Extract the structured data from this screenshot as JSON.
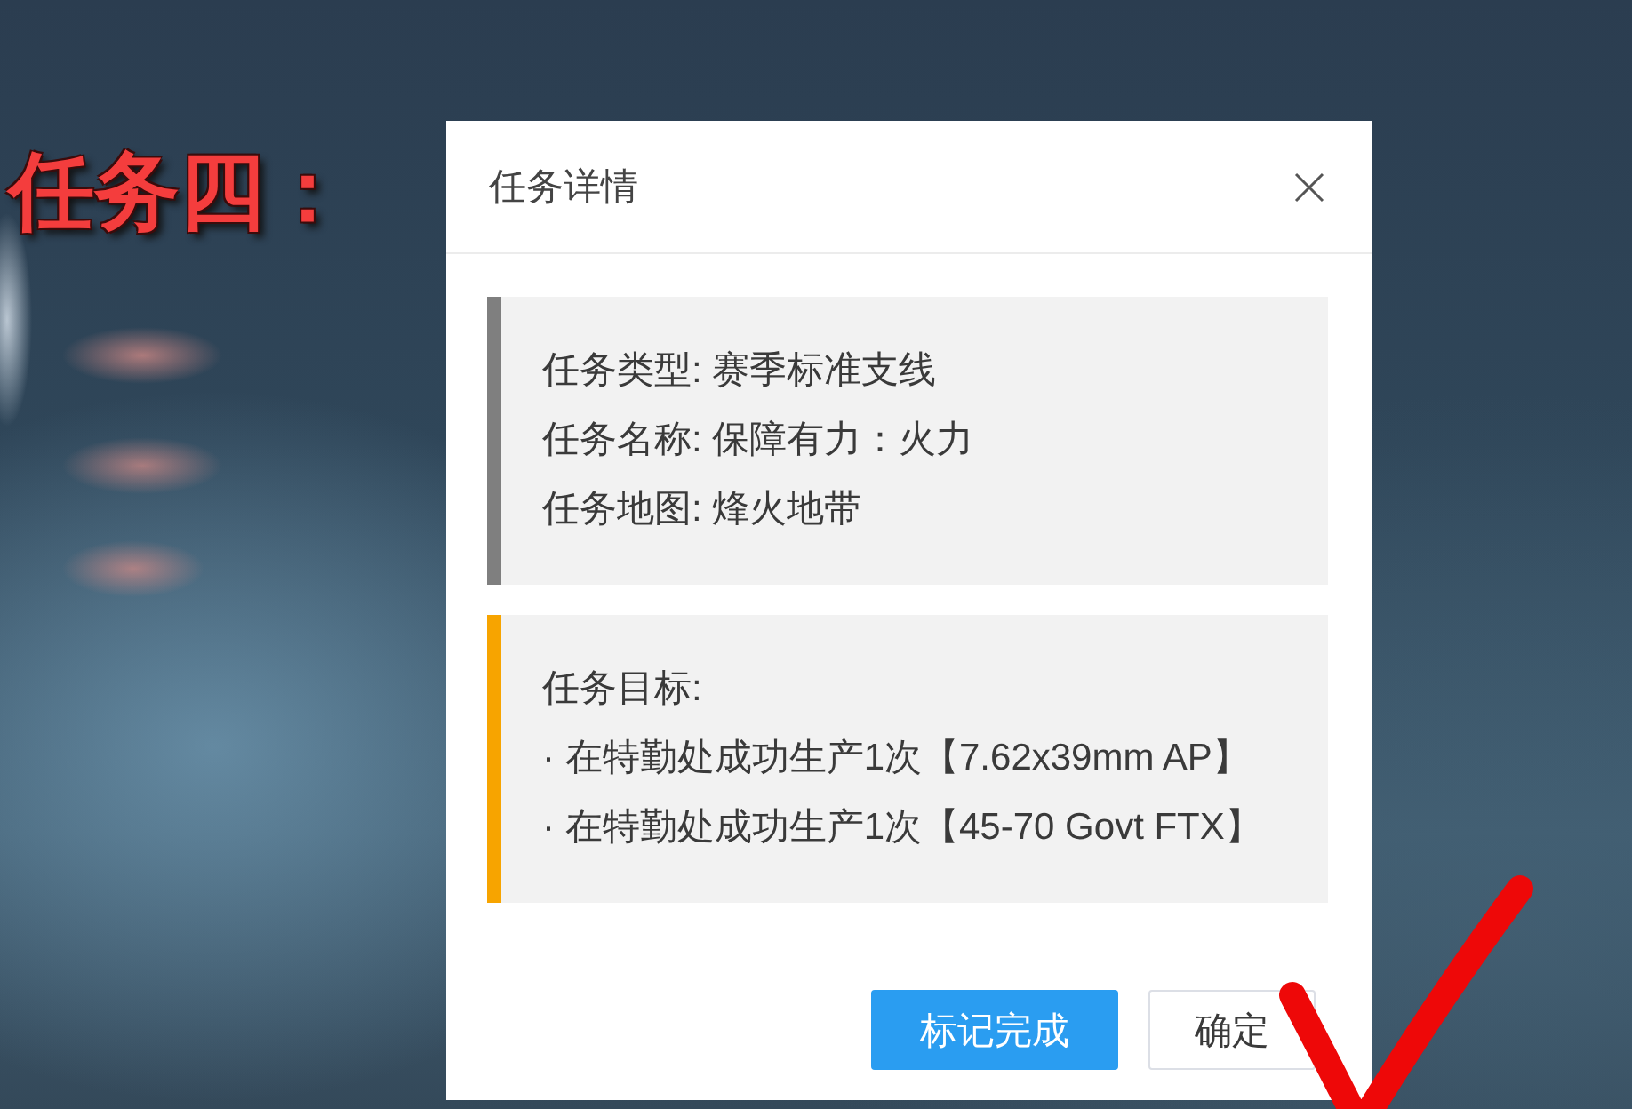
{
  "annotation": {
    "text": "任务四："
  },
  "dialog": {
    "title": "任务详情",
    "panels": [
      {
        "color": "#7f7f7f",
        "lines": [
          "任务类型: 赛季标准支线",
          "任务名称: 保障有力：火力",
          "任务地图: 烽火地带"
        ]
      },
      {
        "color": "#f7a400",
        "lines": [
          "任务目标:",
          "· 在特勤处成功生产1次【7.62x39mm AP】",
          "· 在特勤处成功生产1次【45-70 Govt FTX】"
        ]
      }
    ],
    "buttons": [
      {
        "label": "标记完成",
        "kind": "primary"
      },
      {
        "label": "确定",
        "kind": "default"
      }
    ]
  }
}
